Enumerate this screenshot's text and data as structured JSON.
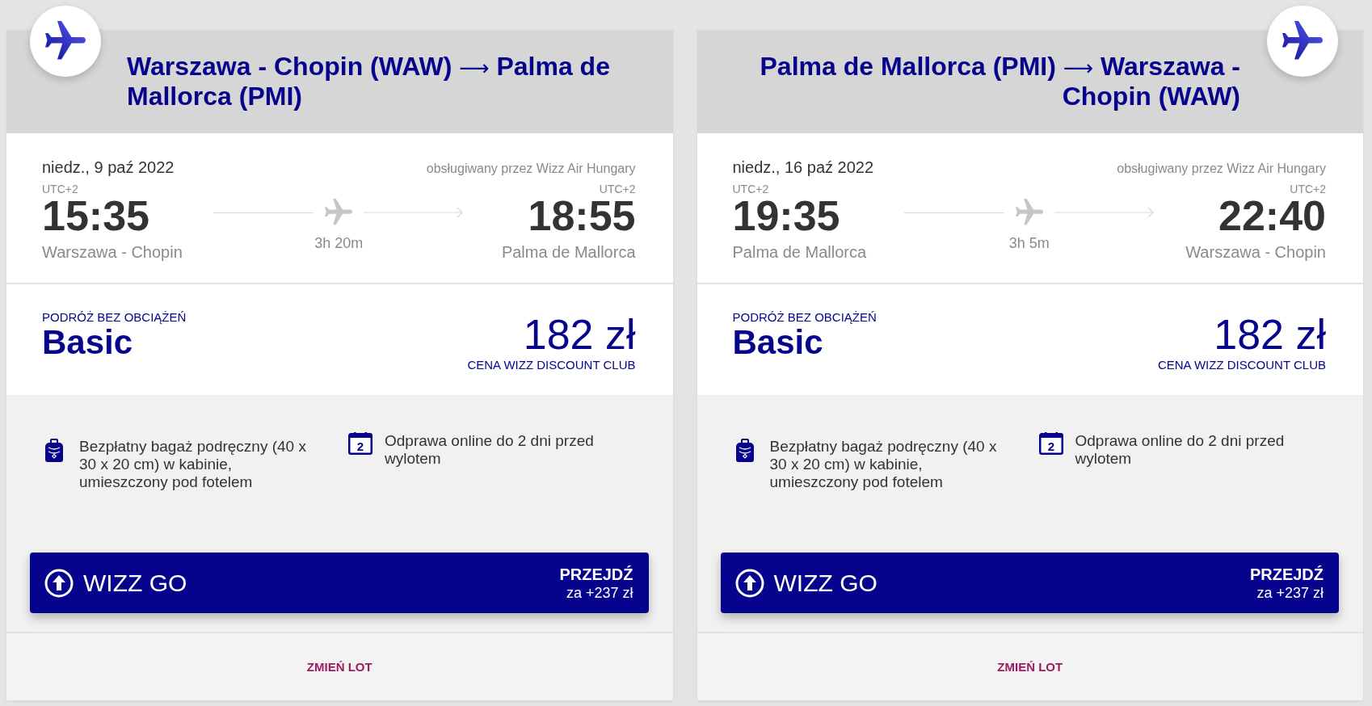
{
  "flights": [
    {
      "kind": "outbound",
      "route": {
        "from": "Warszawa - Chopin (WAW)",
        "arrow": "⟶",
        "to": "Palma de Mallorca (PMI)"
      },
      "date": "niedz., 9 paź 2022",
      "operator": "obsługiwany przez Wizz Air Hungary",
      "departure": {
        "timezone": "UTC+2",
        "time": "15:35",
        "airport": "Warszawa - Chopin"
      },
      "duration": "3h 20m",
      "arrival": {
        "timezone": "UTC+2",
        "time": "18:55",
        "airport": "Palma de Mallorca"
      },
      "fare": {
        "label": "PODRÓŻ BEZ OBCIĄŻEŃ",
        "name": "Basic",
        "price": "182 zł",
        "price_note": "CENA WIZZ DISCOUNT CLUB"
      },
      "features": [
        {
          "kind": "baggage",
          "text": "Bezpłatny bagaż podręczny (40 x 30 x 20 cm) w kabinie, umieszczony pod fotelem"
        },
        {
          "kind": "checkin",
          "day": "2",
          "text": "Odprawa online do 2 dni przed wylotem"
        }
      ],
      "upgrade": {
        "name": "WIZZ GO",
        "action": "PRZEJDŹ",
        "price": "za +237 zł"
      },
      "change_link": "ZMIEŃ LOT"
    },
    {
      "kind": "return",
      "route": {
        "from": "Palma de Mallorca (PMI)",
        "arrow": "⟶",
        "to": "Warszawa - Chopin (WAW)"
      },
      "date": "niedz., 16 paź 2022",
      "operator": "obsługiwany przez Wizz Air Hungary",
      "departure": {
        "timezone": "UTC+2",
        "time": "19:35",
        "airport": "Palma de Mallorca"
      },
      "duration": "3h 5m",
      "arrival": {
        "timezone": "UTC+2",
        "time": "22:40",
        "airport": "Warszawa - Chopin"
      },
      "fare": {
        "label": "PODRÓŻ BEZ OBCIĄŻEŃ",
        "name": "Basic",
        "price": "182 zł",
        "price_note": "CENA WIZZ DISCOUNT CLUB"
      },
      "features": [
        {
          "kind": "baggage",
          "text": "Bezpłatny bagaż podręczny (40 x 30 x 20 cm) w kabinie, umieszczony pod fotelem"
        },
        {
          "kind": "checkin",
          "day": "2",
          "text": "Odprawa online do 2 dni przed wylotem"
        }
      ],
      "upgrade": {
        "name": "WIZZ GO",
        "action": "PRZEJDŹ",
        "price": "za +237 zł"
      },
      "change_link": "ZMIEŃ LOT"
    }
  ]
}
